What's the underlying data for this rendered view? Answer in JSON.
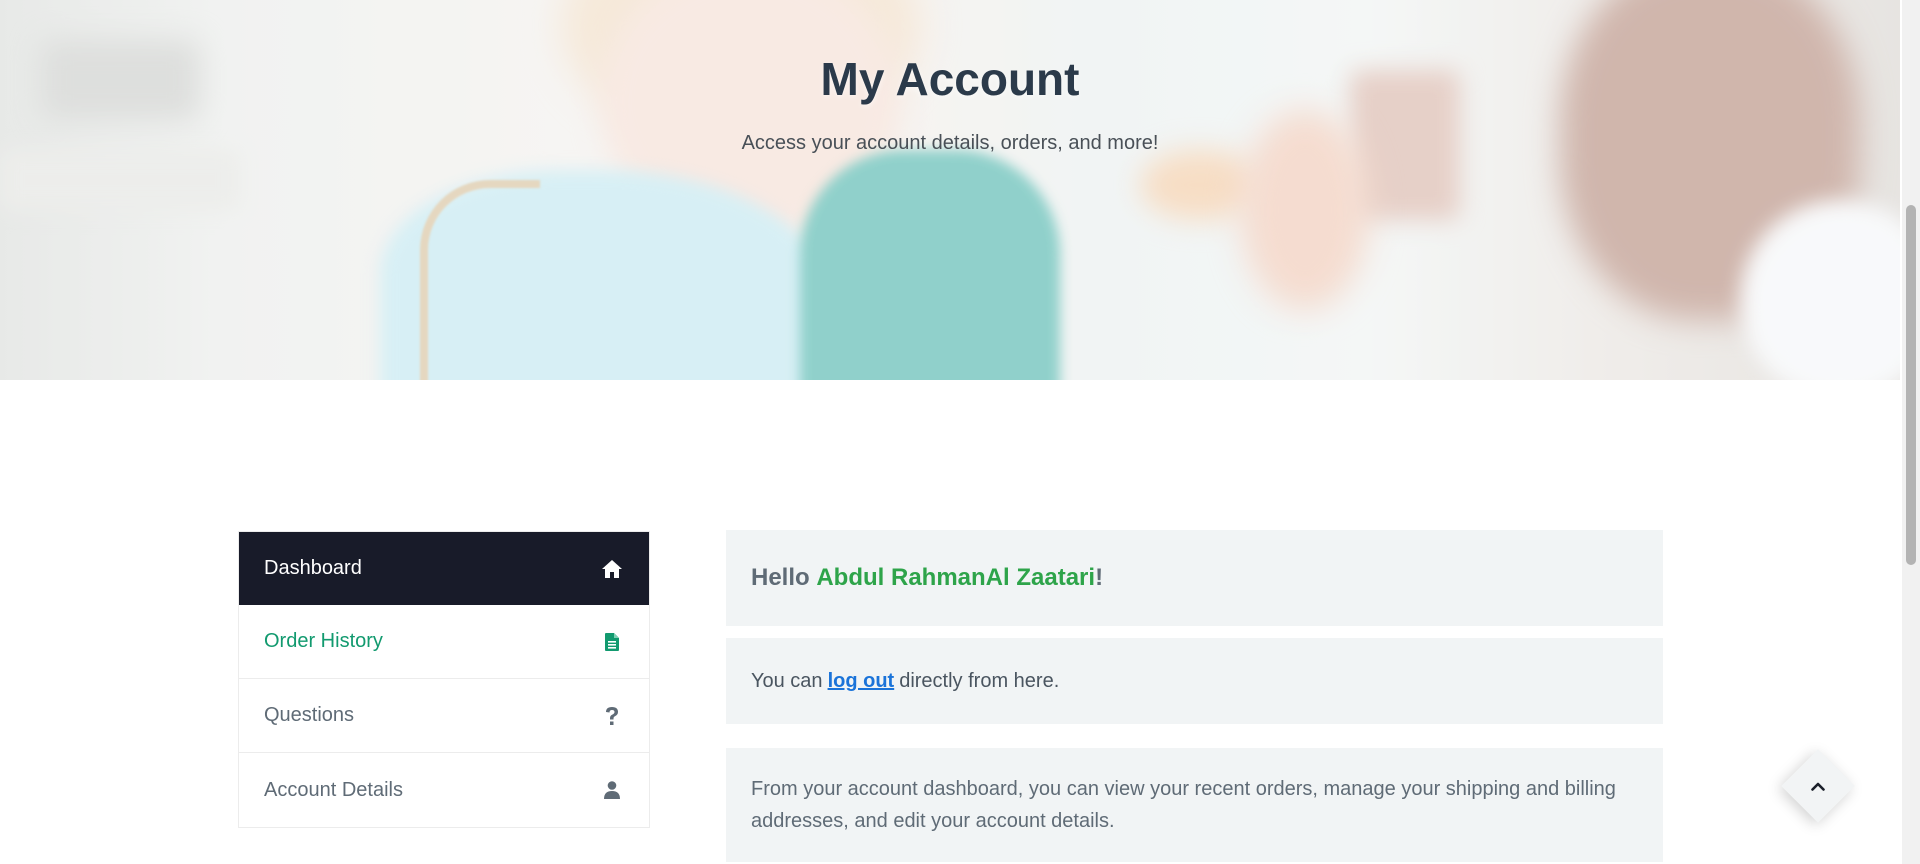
{
  "hero": {
    "title": "My Account",
    "subtitle": "Access your account details, orders, and more!"
  },
  "sidebar": {
    "items": [
      {
        "label": "Dashboard",
        "icon": "home-icon",
        "state": "active"
      },
      {
        "label": "Order History",
        "icon": "document-icon",
        "state": "highlight"
      },
      {
        "label": "Questions",
        "icon": "question-icon",
        "state": "normal"
      },
      {
        "label": "Account Details",
        "icon": "user-icon",
        "state": "normal"
      }
    ]
  },
  "dashboard": {
    "greeting_prefix": "Hello ",
    "user_name": "Abdul RahmanAl Zaatari",
    "greeting_suffix": "!",
    "logout_prefix": "You can",
    "logout_link": "log out",
    "logout_suffix": "directly from here.",
    "info": "From your account dashboard, you can view your recent orders, manage your shipping and billing addresses, and edit your account details."
  },
  "colors": {
    "nav_active_bg": "#181b29",
    "accent_green": "#2ea44a",
    "order_history_green": "#129a6f",
    "link_blue": "#1a73d9",
    "panel_bg": "#f1f4f5"
  },
  "back_to_top": {
    "icon": "chevron-up-icon"
  }
}
